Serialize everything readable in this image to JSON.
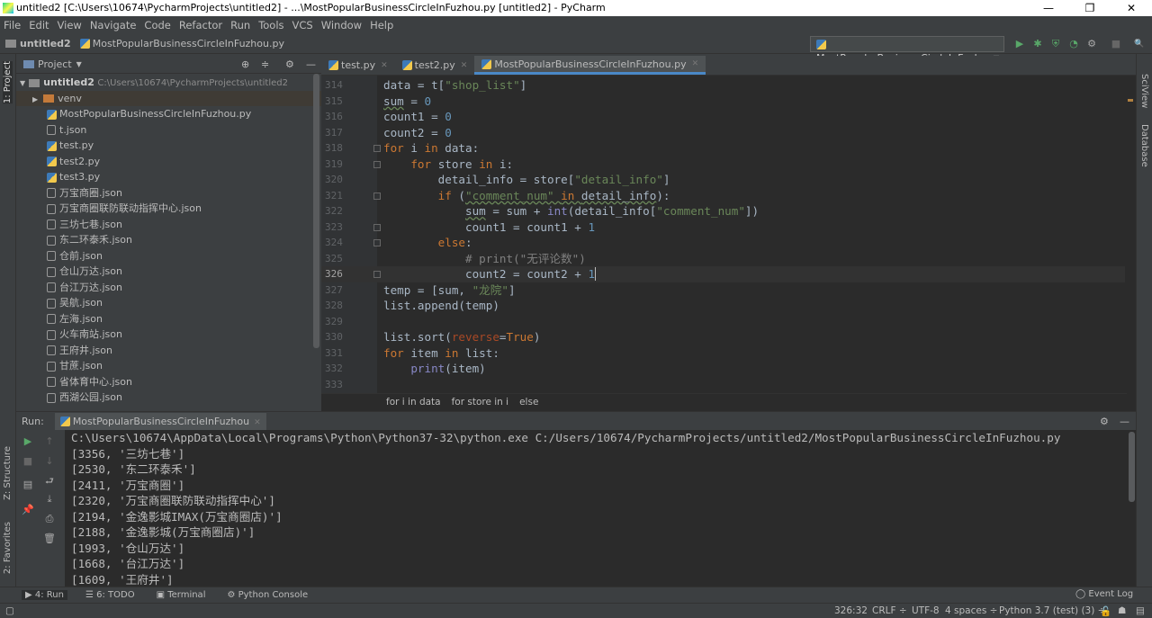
{
  "window": {
    "title": "untitled2 [C:\\Users\\10674\\PycharmProjects\\untitled2] - ...\\MostPopularBusinessCircleInFuzhou.py [untitled2] - PyCharm",
    "minimize": "—",
    "maximize": "❐",
    "close": "✕"
  },
  "menu": [
    "File",
    "Edit",
    "View",
    "Navigate",
    "Code",
    "Refactor",
    "Run",
    "Tools",
    "VCS",
    "Window",
    "Help"
  ],
  "nav": {
    "project": "untitled2",
    "file": "MostPopularBusinessCircleInFuzhou.py"
  },
  "toolbar": {
    "run_config": "MostPopularBusinessCircleInFuzhou",
    "run": "▶",
    "debug": "✱",
    "coverage": "⛨",
    "profile": "◔",
    "build": "⚙",
    "stop": "■",
    "search": "🔍"
  },
  "left_strip": {
    "project": "1: Project",
    "structure": "Z: Structure",
    "favorites": "2: Favorites"
  },
  "right_strip": {
    "sciview": "SciView",
    "database": "Database"
  },
  "project_panel": {
    "title": "Project",
    "root": "untitled2",
    "root_path": "C:\\Users\\10674\\PycharmProjects\\untitled2",
    "items": [
      {
        "name": "venv",
        "type": "folder"
      },
      {
        "name": "MostPopularBusinessCircleInFuzhou.py",
        "type": "py"
      },
      {
        "name": "t.json",
        "type": "json"
      },
      {
        "name": "test.py",
        "type": "py"
      },
      {
        "name": "test2.py",
        "type": "py"
      },
      {
        "name": "test3.py",
        "type": "py"
      },
      {
        "name": "万宝商圈.json",
        "type": "json"
      },
      {
        "name": "万宝商圈联防联动指挥中心.json",
        "type": "json"
      },
      {
        "name": "三坊七巷.json",
        "type": "json"
      },
      {
        "name": "东二环泰禾.json",
        "type": "json"
      },
      {
        "name": "仓前.json",
        "type": "json"
      },
      {
        "name": "仓山万达.json",
        "type": "json"
      },
      {
        "name": "台江万达.json",
        "type": "json"
      },
      {
        "name": "吴航.json",
        "type": "json"
      },
      {
        "name": "左海.json",
        "type": "json"
      },
      {
        "name": "火车南站.json",
        "type": "json"
      },
      {
        "name": "王府井.json",
        "type": "json"
      },
      {
        "name": "甘蔗.json",
        "type": "json"
      },
      {
        "name": "省体育中心.json",
        "type": "json"
      },
      {
        "name": "西湖公园.json",
        "type": "json"
      }
    ]
  },
  "editor": {
    "tabs": [
      {
        "label": "test.py",
        "active": false
      },
      {
        "label": "test2.py",
        "active": false
      },
      {
        "label": "MostPopularBusinessCircleInFuzhou.py",
        "active": true
      }
    ],
    "current_line": 326,
    "lines": [
      {
        "n": "314",
        "t": [
          [
            "data = t[",
            ""
          ],
          [
            "\"shop_list\"",
            "str"
          ],
          [
            "]",
            ""
          ]
        ]
      },
      {
        "n": "315",
        "t": [
          [
            "sum",
            "wv"
          ],
          [
            " = ",
            ""
          ],
          [
            "0",
            "num"
          ]
        ]
      },
      {
        "n": "316",
        "t": [
          [
            "count1 = ",
            ""
          ],
          [
            "0",
            "num"
          ]
        ]
      },
      {
        "n": "317",
        "t": [
          [
            "count2 = ",
            ""
          ],
          [
            "0",
            "num"
          ]
        ]
      },
      {
        "n": "318",
        "t": [
          [
            "for ",
            "kw"
          ],
          [
            "i ",
            ""
          ],
          [
            "in ",
            "kw"
          ],
          [
            "data:",
            ""
          ]
        ]
      },
      {
        "n": "319",
        "t": [
          [
            "    ",
            ""
          ],
          [
            "for ",
            "kw"
          ],
          [
            "store ",
            ""
          ],
          [
            "in ",
            "kw"
          ],
          [
            "i:",
            ""
          ]
        ]
      },
      {
        "n": "320",
        "t": [
          [
            "        detail_info = store[",
            ""
          ],
          [
            "\"detail_info\"",
            "str"
          ],
          [
            "]",
            ""
          ]
        ]
      },
      {
        "n": "321",
        "t": [
          [
            "        ",
            ""
          ],
          [
            "if ",
            "kw"
          ],
          [
            "(",
            ""
          ],
          [
            "\"comment_num\" ",
            "str wv"
          ],
          [
            "in ",
            "kw wv"
          ],
          [
            "detail_info",
            "wv"
          ],
          [
            "):",
            ""
          ]
        ]
      },
      {
        "n": "322",
        "t": [
          [
            "            ",
            ""
          ],
          [
            "sum",
            "wv"
          ],
          [
            " = sum + ",
            ""
          ],
          [
            "int",
            "bi"
          ],
          [
            "(detail_info[",
            ""
          ],
          [
            "\"comment_num\"",
            "str"
          ],
          [
            "])",
            ""
          ]
        ]
      },
      {
        "n": "323",
        "t": [
          [
            "            count1 = count1 + ",
            ""
          ],
          [
            "1",
            "num"
          ]
        ]
      },
      {
        "n": "324",
        "t": [
          [
            "        ",
            ""
          ],
          [
            "else",
            "kw"
          ],
          [
            ":",
            ""
          ]
        ]
      },
      {
        "n": "325",
        "t": [
          [
            "            ",
            ""
          ],
          [
            "# print(\"无评论数\")",
            "cm"
          ]
        ]
      },
      {
        "n": "326",
        "t": [
          [
            "            count2 = count2 + ",
            ""
          ],
          [
            "1",
            "num"
          ]
        ]
      },
      {
        "n": "327",
        "t": [
          [
            "temp = [sum, ",
            ""
          ],
          [
            "\"龙院\"",
            "str"
          ],
          [
            "]",
            ""
          ]
        ]
      },
      {
        "n": "328",
        "t": [
          [
            "list.append(temp)",
            ""
          ]
        ]
      },
      {
        "n": "329",
        "t": []
      },
      {
        "n": "330",
        "t": [
          [
            "list.sort(",
            ""
          ],
          [
            "reverse",
            "prm"
          ],
          [
            "=",
            ""
          ],
          [
            "True",
            "kw"
          ],
          [
            ")",
            ""
          ]
        ]
      },
      {
        "n": "331",
        "t": [
          [
            "for ",
            "kw"
          ],
          [
            "item ",
            ""
          ],
          [
            "in ",
            "kw"
          ],
          [
            "list:",
            ""
          ]
        ]
      },
      {
        "n": "332",
        "t": [
          [
            "    ",
            ""
          ],
          [
            "print",
            "bi"
          ],
          [
            "(item)",
            ""
          ]
        ]
      },
      {
        "n": "333",
        "t": []
      }
    ],
    "breadcrumb": [
      "for i in data",
      "for store in i",
      "else"
    ]
  },
  "run_panel": {
    "label": "Run:",
    "tab": "MostPopularBusinessCircleInFuzhou",
    "output": [
      "C:\\Users\\10674\\AppData\\Local\\Programs\\Python\\Python37-32\\python.exe C:/Users/10674/PycharmProjects/untitled2/MostPopularBusinessCircleInFuzhou.py",
      "[3356, '三坊七巷']",
      "[2530, '东二环泰禾']",
      "[2411, '万宝商圈']",
      "[2320, '万宝商圈联防联动指挥中心']",
      "[2194, '金逸影城IMAX(万宝商圈店)']",
      "[2188, '金逸影城(万宝商圈店)']",
      "[1993, '仓山万达']",
      "[1668, '台江万达']",
      "[1609, '王府井']"
    ]
  },
  "bottom_tools": [
    "▶ 4: Run",
    "☰ 6: TODO",
    "▣ Terminal",
    "⚙ Python Console"
  ],
  "event_log": "Event Log",
  "status": {
    "position": "326:32",
    "line_sep": "CRLF ÷",
    "encoding": "UTF-8",
    "indent": "4 spaces ÷",
    "interpreter": "Python 3.7 (test) (3) ÷"
  },
  "colors": {
    "editor_bg": "#2b2b2b",
    "panel_bg": "#3c3f41",
    "keyword": "#cc7832",
    "string": "#6a8759",
    "number": "#6897bb",
    "accent": "#4a88c7"
  }
}
